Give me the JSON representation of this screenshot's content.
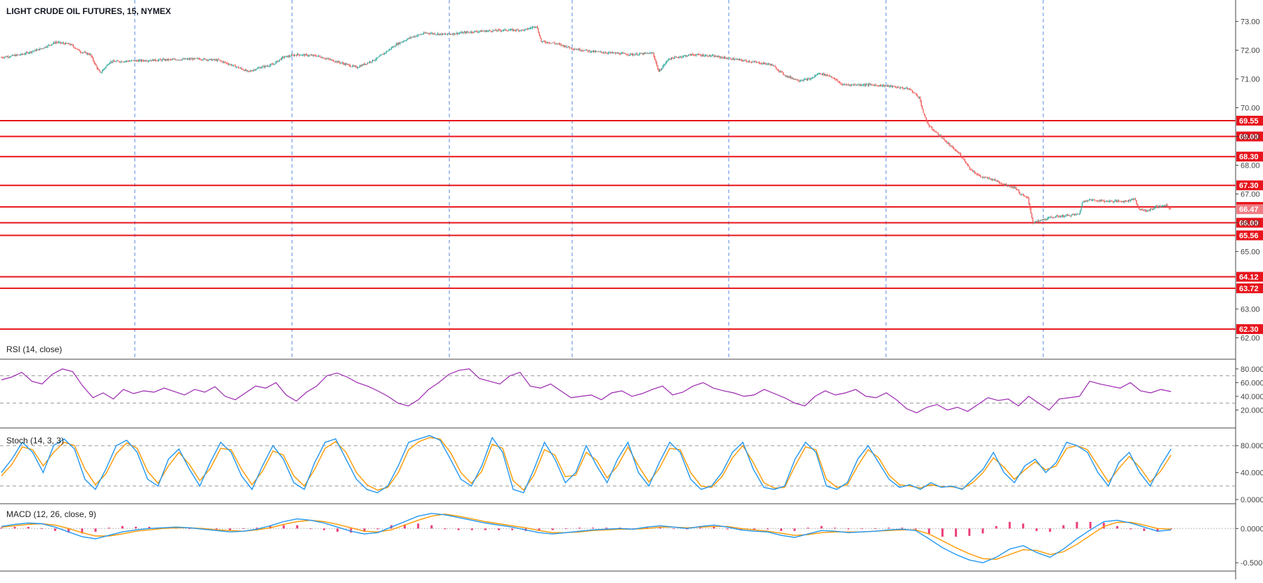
{
  "chart_data": [
    {
      "type": "candlestick",
      "title": "LIGHT CRUDE OIL FUTURES, 15, NYMEX",
      "ylim": [
        61.4,
        73.6
      ],
      "y_ticks": [
        "73.00",
        "72.00",
        "71.00",
        "70.00",
        "69.00",
        "68.00",
        "67.00",
        "66.00",
        "65.00",
        "63.00",
        "62.00"
      ],
      "y_tick_values": [
        73,
        72,
        71,
        70,
        69,
        68,
        67,
        66,
        65,
        63,
        62
      ],
      "last_price": 66.47,
      "horizontal_levels": [
        {
          "value": 69.55,
          "label": "69.55"
        },
        {
          "value": 69.0,
          "label": "69.00"
        },
        {
          "value": 68.3,
          "label": "68.30"
        },
        {
          "value": 67.3,
          "label": "67.30"
        },
        {
          "value": 66.55,
          "label": "66.55"
        },
        {
          "value": 66.0,
          "label": "66.00"
        },
        {
          "value": 65.56,
          "label": "65.56"
        },
        {
          "value": 64.12,
          "label": "64.12"
        },
        {
          "value": 63.72,
          "label": "63.72"
        },
        {
          "value": 62.3,
          "label": "62.30"
        }
      ],
      "price_path": [
        [
          0,
          71.75
        ],
        [
          20,
          71.85
        ],
        [
          40,
          72.05
        ],
        [
          55,
          72.28
        ],
        [
          70,
          72.2
        ],
        [
          80,
          71.95
        ],
        [
          90,
          71.85
        ],
        [
          95,
          71.5
        ],
        [
          100,
          71.2
        ],
        [
          110,
          71.6
        ],
        [
          150,
          71.65
        ],
        [
          200,
          71.7
        ],
        [
          220,
          71.65
        ],
        [
          240,
          71.4
        ],
        [
          250,
          71.25
        ],
        [
          262,
          71.4
        ],
        [
          275,
          71.5
        ],
        [
          285,
          71.75
        ],
        [
          300,
          71.85
        ],
        [
          320,
          71.8
        ],
        [
          340,
          71.6
        ],
        [
          360,
          71.4
        ],
        [
          380,
          71.7
        ],
        [
          400,
          72.2
        ],
        [
          415,
          72.45
        ],
        [
          430,
          72.6
        ],
        [
          450,
          72.55
        ],
        [
          480,
          72.65
        ],
        [
          510,
          72.7
        ],
        [
          530,
          72.7
        ],
        [
          542,
          72.85
        ],
        [
          547,
          72.3
        ],
        [
          560,
          72.25
        ],
        [
          580,
          72.05
        ],
        [
          600,
          71.95
        ],
        [
          620,
          71.9
        ],
        [
          640,
          71.85
        ],
        [
          660,
          71.9
        ],
        [
          666,
          71.25
        ],
        [
          676,
          71.7
        ],
        [
          700,
          71.85
        ],
        [
          720,
          71.8
        ],
        [
          740,
          71.7
        ],
        [
          760,
          71.6
        ],
        [
          780,
          71.5
        ],
        [
          795,
          71.1
        ],
        [
          808,
          70.95
        ],
        [
          820,
          71.0
        ],
        [
          828,
          71.2
        ],
        [
          840,
          71.1
        ],
        [
          852,
          70.8
        ],
        [
          880,
          70.8
        ],
        [
          900,
          70.75
        ],
        [
          920,
          70.65
        ],
        [
          930,
          70.35
        ],
        [
          935,
          69.7
        ],
        [
          940,
          69.35
        ],
        [
          950,
          69.05
        ],
        [
          962,
          68.65
        ],
        [
          972,
          68.35
        ],
        [
          982,
          67.85
        ],
        [
          992,
          67.6
        ],
        [
          1005,
          67.5
        ],
        [
          1015,
          67.35
        ],
        [
          1028,
          67.2
        ],
        [
          1032,
          67.0
        ],
        [
          1040,
          66.85
        ],
        [
          1045,
          66.0
        ],
        [
          1055,
          66.1
        ],
        [
          1065,
          66.2
        ],
        [
          1080,
          66.25
        ],
        [
          1092,
          66.3
        ],
        [
          1095,
          66.7
        ],
        [
          1100,
          66.8
        ],
        [
          1120,
          66.75
        ],
        [
          1140,
          66.75
        ],
        [
          1148,
          66.85
        ],
        [
          1152,
          66.5
        ],
        [
          1160,
          66.4
        ],
        [
          1170,
          66.55
        ],
        [
          1180,
          66.6
        ],
        [
          1185,
          66.47
        ]
      ],
      "series_colors": {
        "up": "#26a69a",
        "down": "#ef5350"
      }
    },
    {
      "type": "line",
      "title": "RSI (14, close)",
      "ylim": [
        0,
        88
      ],
      "y_ticks": [
        "80.000",
        "60.000",
        "40.000",
        "20.000"
      ],
      "y_tick_values": [
        80,
        60,
        40,
        20
      ],
      "bands": [
        70,
        30
      ],
      "series": [
        {
          "values": [
            64,
            68,
            75,
            62,
            58,
            72,
            80,
            76,
            55,
            38,
            45,
            36,
            50,
            44,
            48,
            46,
            52,
            47,
            42,
            50,
            46,
            54,
            40,
            35,
            45,
            55,
            52,
            60,
            42,
            33,
            46,
            55,
            70,
            74,
            68,
            60,
            55,
            48,
            40,
            30,
            26,
            35,
            50,
            60,
            72,
            78,
            80,
            66,
            62,
            58,
            70,
            75,
            55,
            52,
            58,
            48,
            38,
            40,
            42,
            35,
            45,
            48,
            40,
            44,
            50,
            55,
            42,
            46,
            55,
            60,
            52,
            48,
            45,
            40,
            42,
            50,
            44,
            38,
            30,
            26,
            40,
            48,
            42,
            45,
            50,
            40,
            38,
            45,
            35,
            22,
            16,
            24,
            28,
            20,
            24,
            18,
            28,
            38,
            34,
            36,
            26,
            40,
            30,
            20,
            36,
            38,
            40,
            62,
            58,
            55,
            52,
            60,
            48,
            45,
            50,
            47
          ]
        }
      ],
      "series_colors": {
        "line": "#9c27b0"
      }
    },
    {
      "type": "line",
      "title": "Stoch (14, 3, 3)",
      "ylim": [
        0,
        100
      ],
      "y_ticks": [
        "80.000",
        "40.000",
        "0.0000"
      ],
      "y_tick_values": [
        80,
        40,
        0
      ],
      "bands": [
        80,
        20
      ],
      "series": [
        {
          "values": [
            40,
            60,
            85,
            70,
            40,
            80,
            90,
            75,
            30,
            15,
            45,
            80,
            88,
            70,
            30,
            20,
            60,
            75,
            45,
            20,
            55,
            85,
            70,
            35,
            15,
            50,
            80,
            60,
            25,
            15,
            55,
            85,
            90,
            60,
            30,
            15,
            10,
            20,
            50,
            85,
            90,
            95,
            88,
            60,
            30,
            20,
            50,
            92,
            70,
            15,
            10,
            45,
            85,
            60,
            25,
            40,
            80,
            50,
            25,
            60,
            85,
            40,
            20,
            55,
            85,
            70,
            30,
            15,
            20,
            40,
            70,
            85,
            45,
            18,
            15,
            20,
            60,
            85,
            70,
            20,
            15,
            25,
            60,
            80,
            55,
            30,
            18,
            22,
            15,
            25,
            18,
            20,
            15,
            30,
            45,
            70,
            40,
            25,
            50,
            60,
            40,
            55,
            85,
            80,
            70,
            40,
            20,
            55,
            70,
            40,
            20,
            50,
            75
          ]
        },
        {
          "values": [
            35,
            52,
            78,
            74,
            50,
            70,
            85,
            80,
            45,
            22,
            38,
            68,
            84,
            76,
            42,
            24,
            50,
            70,
            52,
            28,
            46,
            76,
            74,
            45,
            22,
            42,
            72,
            66,
            35,
            20,
            45,
            76,
            86,
            70,
            40,
            22,
            14,
            18,
            40,
            74,
            86,
            92,
            90,
            70,
            40,
            24,
            42,
            82,
            76,
            28,
            14,
            36,
            74,
            66,
            34,
            36,
            70,
            58,
            32,
            50,
            78,
            50,
            26,
            46,
            76,
            74,
            40,
            20,
            18,
            34,
            62,
            80,
            55,
            25,
            17,
            18,
            50,
            78,
            74,
            30,
            18,
            22,
            50,
            74,
            62,
            36,
            22,
            20,
            17,
            22,
            19,
            19,
            16,
            25,
            40,
            62,
            48,
            30,
            44,
            56,
            44,
            50,
            76,
            80,
            74,
            50,
            26,
            46,
            64,
            48,
            26,
            42,
            66
          ]
        }
      ],
      "series_colors": {
        "k": "#2196f3",
        "d": "#ff9800"
      }
    },
    {
      "type": "line",
      "title": "MACD (12, 26, close, 9)",
      "ylim": [
        -0.56,
        0.3
      ],
      "y_ticks": [
        "0.0000",
        "-0.500"
      ],
      "y_tick_values": [
        0,
        -0.5
      ],
      "series": [
        {
          "values": [
            0.03,
            0.06,
            0.08,
            0.07,
            0.02,
            -0.05,
            -0.12,
            -0.15,
            -0.1,
            -0.05,
            -0.02,
            0.0,
            0.01,
            0.02,
            0.01,
            -0.01,
            -0.03,
            -0.05,
            -0.04,
            -0.01,
            0.04,
            0.1,
            0.14,
            0.12,
            0.08,
            0.02,
            -0.04,
            -0.08,
            -0.06,
            0.02,
            0.1,
            0.18,
            0.22,
            0.2,
            0.16,
            0.12,
            0.08,
            0.05,
            0.02,
            -0.02,
            -0.06,
            -0.08,
            -0.06,
            -0.04,
            -0.02,
            -0.01,
            0.0,
            -0.01,
            0.02,
            0.04,
            0.02,
            0.0,
            0.03,
            0.05,
            0.02,
            -0.02,
            -0.04,
            -0.05,
            -0.1,
            -0.13,
            -0.08,
            -0.03,
            -0.04,
            -0.06,
            -0.05,
            -0.04,
            -0.02,
            -0.01,
            -0.03,
            -0.15,
            -0.28,
            -0.38,
            -0.46,
            -0.5,
            -0.42,
            -0.3,
            -0.25,
            -0.35,
            -0.42,
            -0.3,
            -0.15,
            -0.02,
            0.1,
            0.12,
            0.08,
            0.02,
            -0.04,
            -0.02
          ]
        },
        {
          "values": [
            0.02,
            0.04,
            0.06,
            0.07,
            0.05,
            0.0,
            -0.06,
            -0.11,
            -0.11,
            -0.08,
            -0.04,
            -0.02,
            0.0,
            0.01,
            0.01,
            0.0,
            -0.02,
            -0.03,
            -0.04,
            -0.02,
            0.01,
            0.06,
            0.1,
            0.12,
            0.1,
            0.06,
            0.01,
            -0.04,
            -0.05,
            -0.02,
            0.05,
            0.12,
            0.18,
            0.21,
            0.18,
            0.14,
            0.1,
            0.07,
            0.04,
            0.01,
            -0.03,
            -0.06,
            -0.06,
            -0.05,
            -0.03,
            -0.02,
            -0.01,
            -0.01,
            0.0,
            0.02,
            0.02,
            0.01,
            0.02,
            0.03,
            0.03,
            0.0,
            -0.02,
            -0.04,
            -0.07,
            -0.1,
            -0.09,
            -0.06,
            -0.05,
            -0.05,
            -0.05,
            -0.04,
            -0.03,
            -0.02,
            -0.02,
            -0.08,
            -0.18,
            -0.28,
            -0.37,
            -0.44,
            -0.45,
            -0.38,
            -0.31,
            -0.32,
            -0.38,
            -0.34,
            -0.23,
            -0.1,
            0.03,
            0.09,
            0.09,
            0.05,
            0.0,
            -0.01
          ]
        }
      ],
      "series_colors": {
        "macd": "#2196f3",
        "signal": "#ff9800",
        "histogram": "#e91e63"
      }
    }
  ]
}
